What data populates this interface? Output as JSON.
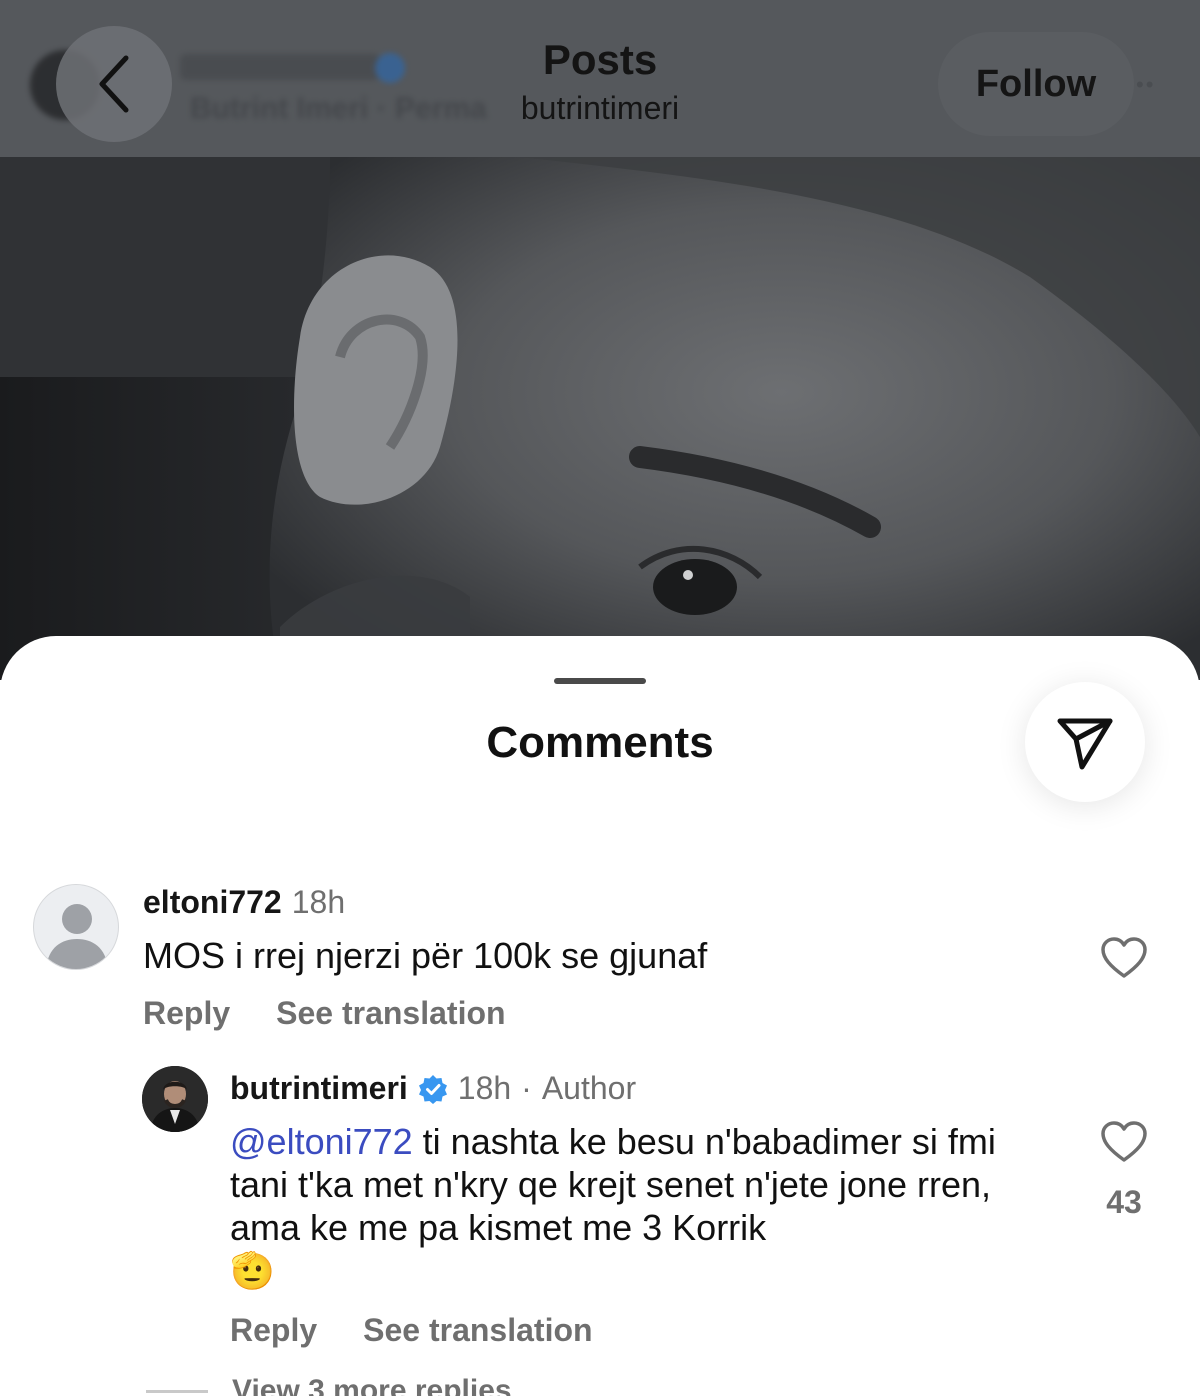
{
  "header": {
    "title": "Posts",
    "username": "butrintimeri",
    "follow_label": "Follow",
    "ghost_subtitle": "Butrint Imeri · Perma"
  },
  "sheet": {
    "title": "Comments"
  },
  "comments": [
    {
      "username": "eltoni772",
      "time": "18h",
      "text": "MOS i rrej njerzi për 100k se gjunaf",
      "reply_label": "Reply",
      "translate_label": "See translation"
    },
    {
      "username": "butrintimeri",
      "time": "18h",
      "separator": "·",
      "badge": "Author",
      "mention": "@eltoni772",
      "text": " ti nashta ke besu n'babadimer si fmi tani t'ka met n'kry qe krejt senet n'jete jone rren, ama ke me pa kismet me 3 Korrik",
      "emoji": "🫡",
      "likes": "43",
      "reply_label": "Reply",
      "translate_label": "See translation"
    }
  ],
  "view_more_label": "View 3 more replies",
  "colors": {
    "mention": "#3b4cc0",
    "verified": "#3897f0",
    "secondary_text": "#6f6f6f"
  },
  "icons": [
    "back-chevron-icon",
    "more-icon",
    "share-icon",
    "heart-icon",
    "verified-icon",
    "default-avatar-icon"
  ]
}
